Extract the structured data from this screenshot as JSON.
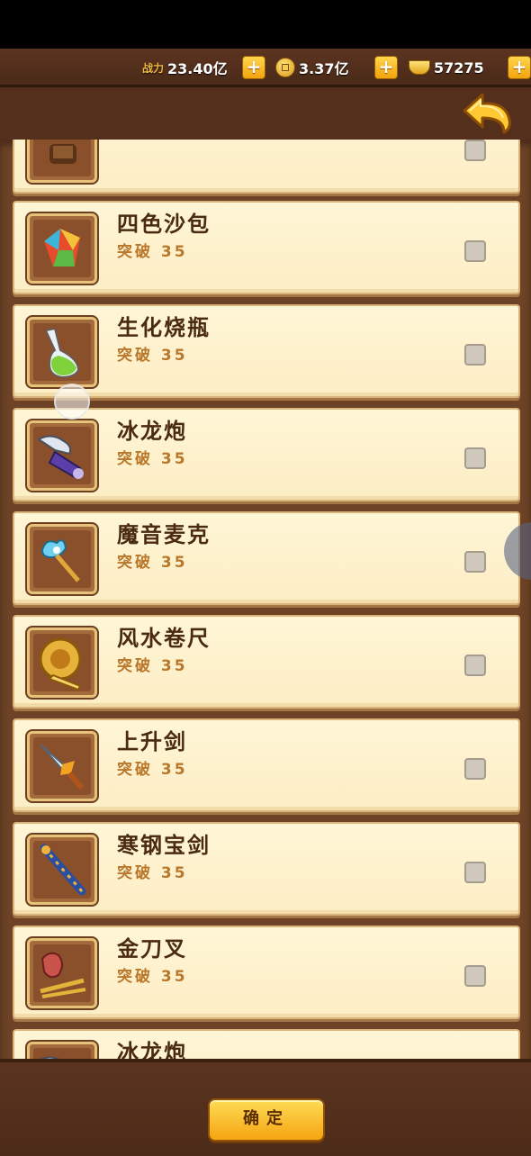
{
  "resources": {
    "power_label": "战力",
    "power_value": "23.40亿",
    "coins_value": "3.37亿",
    "ingots_value": "57275",
    "plus": "+"
  },
  "items": [
    {
      "name": "",
      "sub": "",
      "icon": "scroll-icon"
    },
    {
      "name": "四色沙包",
      "sub": "突破 35",
      "icon": "sandbag-icon"
    },
    {
      "name": "生化烧瓶",
      "sub": "突破 35",
      "icon": "flask-icon"
    },
    {
      "name": "冰龙炮",
      "sub": "突破 35",
      "icon": "ice-dragon-cannon-icon"
    },
    {
      "name": "魔音麦克",
      "sub": "突破 35",
      "icon": "magic-mic-icon"
    },
    {
      "name": "风水卷尺",
      "sub": "突破 35",
      "icon": "tape-measure-icon"
    },
    {
      "name": "上升剑",
      "sub": "突破 35",
      "icon": "rising-sword-icon"
    },
    {
      "name": "寒钢宝剑",
      "sub": "突破 35",
      "icon": "steel-sword-icon"
    },
    {
      "name": "金刀叉",
      "sub": "突破 35",
      "icon": "golden-cutlery-icon"
    },
    {
      "name": "冰龙炮",
      "sub": "",
      "icon": "ice-dragon-cannon-icon"
    }
  ],
  "confirm_label": "确定",
  "colors": {
    "panel": "#fff6d6",
    "wood": "#54301c",
    "accent": "#f5a512",
    "text": "#4a2a12"
  }
}
